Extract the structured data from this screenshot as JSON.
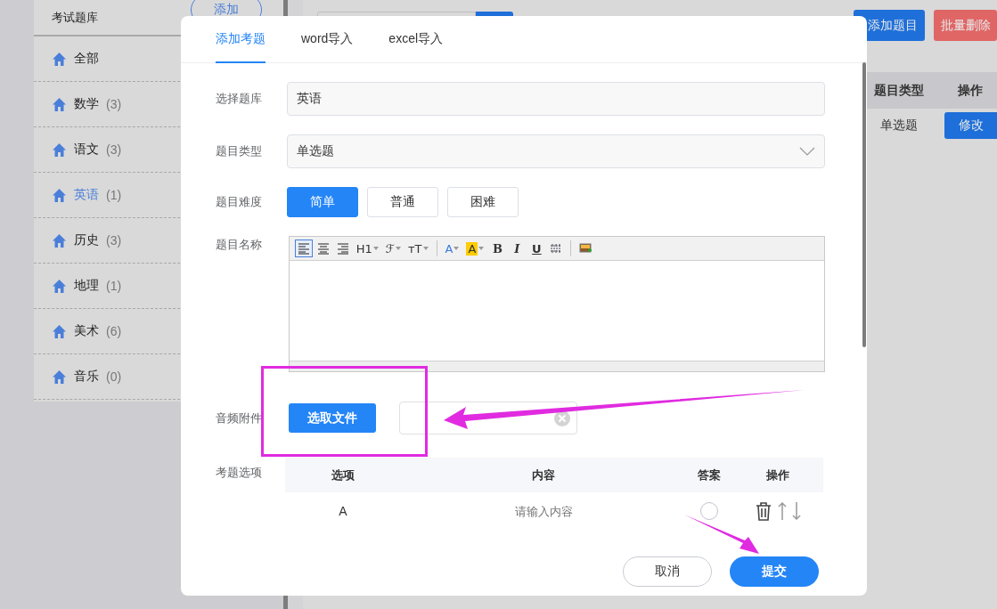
{
  "sidebar": {
    "title": "考试题库",
    "add_button": "添加",
    "items": [
      {
        "label": "全部",
        "selected": false
      },
      {
        "label": "数学",
        "count": "(3)",
        "selected": false
      },
      {
        "label": "语文",
        "count": "(3)",
        "selected": false
      },
      {
        "label": "英语",
        "count": "(1)",
        "selected": true
      },
      {
        "label": "历史",
        "count": "(3)",
        "selected": false
      },
      {
        "label": "地理",
        "count": "(1)",
        "selected": false
      },
      {
        "label": "美术",
        "count": "(6)",
        "selected": false
      },
      {
        "label": "音乐",
        "count": "(0)",
        "selected": false
      }
    ]
  },
  "toolbar": {
    "buttons": [
      {
        "label": "添加题目",
        "kind": "primary"
      },
      {
        "label": "批量删除",
        "kind": "danger"
      }
    ]
  },
  "table": {
    "columns": [
      "题目类型",
      "操作"
    ],
    "rows": [
      {
        "type": "单选题",
        "action": "修改"
      }
    ]
  },
  "dialog": {
    "tabs": [
      {
        "label": "添加考题",
        "selected": true
      },
      {
        "label": "word导入",
        "selected": false
      },
      {
        "label": "excel导入",
        "selected": false
      }
    ],
    "fields": [
      {
        "kind": "text",
        "label": "选择题库",
        "value": "英语"
      },
      {
        "kind": "select",
        "label": "题目类型",
        "value": "单选题"
      },
      {
        "kind": "choices",
        "label": "题目难度",
        "options": [
          {
            "label": "简单",
            "selected": true
          },
          {
            "label": "普通",
            "selected": false
          },
          {
            "label": "困难",
            "selected": false
          }
        ]
      },
      {
        "kind": "editor",
        "label": "题目名称",
        "tools": [
          {
            "kind": "align-left",
            "selected": true
          },
          {
            "kind": "align-center",
            "selected": false
          },
          {
            "kind": "align-right",
            "selected": false
          },
          {
            "kind": "heading",
            "label": "H1",
            "selected": false
          },
          {
            "kind": "font",
            "label": "ℱ",
            "selected": false
          },
          {
            "kind": "size",
            "label": "ᴛT",
            "selected": false
          },
          {
            "kind": "separator"
          },
          {
            "kind": "color",
            "label": "A",
            "selected": false
          },
          {
            "kind": "highlight",
            "label": "A",
            "selected": false
          },
          {
            "kind": "bold",
            "label": "B",
            "selected": false
          },
          {
            "kind": "italic",
            "label": "I",
            "selected": false
          },
          {
            "kind": "underline",
            "label": "U",
            "selected": false
          },
          {
            "kind": "table",
            "selected": false
          },
          {
            "kind": "separator"
          },
          {
            "kind": "image",
            "selected": false
          }
        ]
      },
      {
        "kind": "file",
        "label": "音频附件",
        "button": "选取文件"
      },
      {
        "kind": "options",
        "label": "考题选项",
        "columns": [
          "选项",
          "内容",
          "答案",
          "操作"
        ],
        "rows": [
          {
            "option": "A",
            "placeholder": "请输入内容",
            "answer": false
          }
        ]
      }
    ],
    "buttons": [
      {
        "label": "取消",
        "kind": "default"
      },
      {
        "label": "提交",
        "kind": "primary"
      }
    ]
  }
}
